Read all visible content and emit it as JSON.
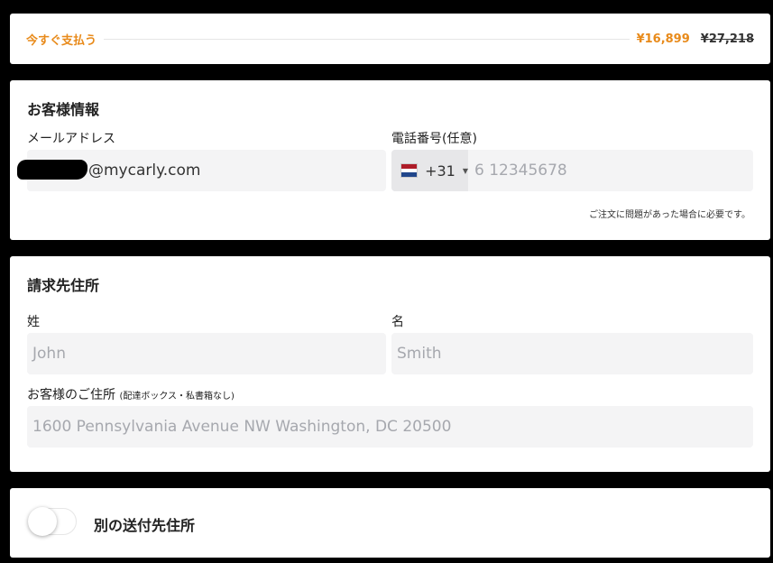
{
  "paybar": {
    "label": "今すぐ支払う",
    "price": "¥16,899",
    "old_price": "¥27,218"
  },
  "customer": {
    "title": "お客様情報",
    "email_label": "メールアドレス",
    "email_value": "@mycarly.com",
    "phone_label": "電話番号(任意)",
    "phone_code": "+31",
    "phone_placeholder": "6 12345678",
    "phone_flag_icon": "netherlands-flag-icon",
    "note": "ご注文に問題があった場合に必要です。"
  },
  "billing": {
    "title": "請求先住所",
    "last_name_label": "姓",
    "last_name_placeholder": "John",
    "first_name_label": "名",
    "first_name_placeholder": "Smith",
    "address_label": "お客様のご住所",
    "address_label_small": "(配達ボックス・私書箱なし)",
    "address_placeholder": "1600 Pennsylvania Avenue NW Washington, DC 20500"
  },
  "shipping": {
    "toggle_label": "別の送付先住所",
    "toggle_on": false
  },
  "colors": {
    "accent": "#e88a1a",
    "input_bg": "#f4f4f5",
    "page_bg": "#000000",
    "flag_red": "#ae1c28",
    "flag_white": "#ffffff",
    "flag_blue": "#21468b"
  }
}
